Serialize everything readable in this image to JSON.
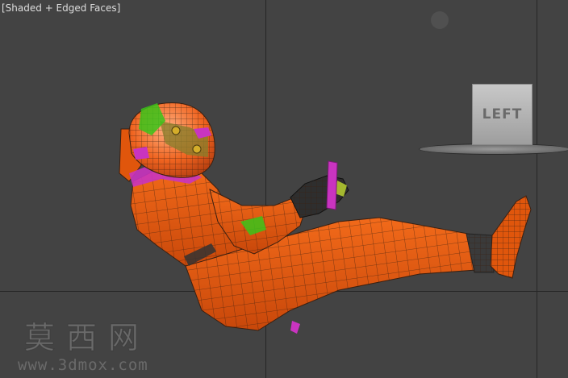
{
  "viewport": {
    "label": "[Shaded + Edged Faces]",
    "background": "#434343",
    "viewcube_label": "LEFT"
  },
  "model": {
    "icon": "race-driver-figure",
    "suit_color": "#e0560c",
    "wire_color": "#3a1f10",
    "accent_colors": [
      "#c934c0",
      "#39c41a",
      "#d4ad2a"
    ]
  },
  "watermark": {
    "chinese": "莫西网",
    "url": "www.3dmox.com"
  }
}
